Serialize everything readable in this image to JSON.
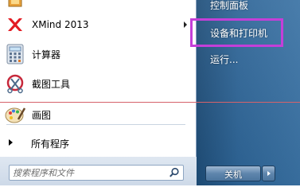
{
  "programs": [
    {
      "label": "",
      "icon": "app-icon-partial"
    },
    {
      "label": "XMind 2013",
      "icon": "xmind-icon",
      "has_submenu": true
    },
    {
      "label": "计算器",
      "icon": "calculator-icon"
    },
    {
      "label": "截图工具",
      "icon": "snipping-tool-icon"
    },
    {
      "label": "画图",
      "icon": "paint-icon"
    }
  ],
  "all_programs": {
    "label": "所有程序"
  },
  "search": {
    "placeholder": "搜索程序和文件"
  },
  "right_items": [
    {
      "label": "控制面板"
    },
    {
      "label": "设备和打印机"
    },
    {
      "label": "运行..."
    }
  ],
  "shutdown": {
    "label": "关机"
  },
  "colors": {
    "highlight_border": "#c43fd8",
    "annotation_line": "#d5626a",
    "right_pane": "#2d6496"
  }
}
